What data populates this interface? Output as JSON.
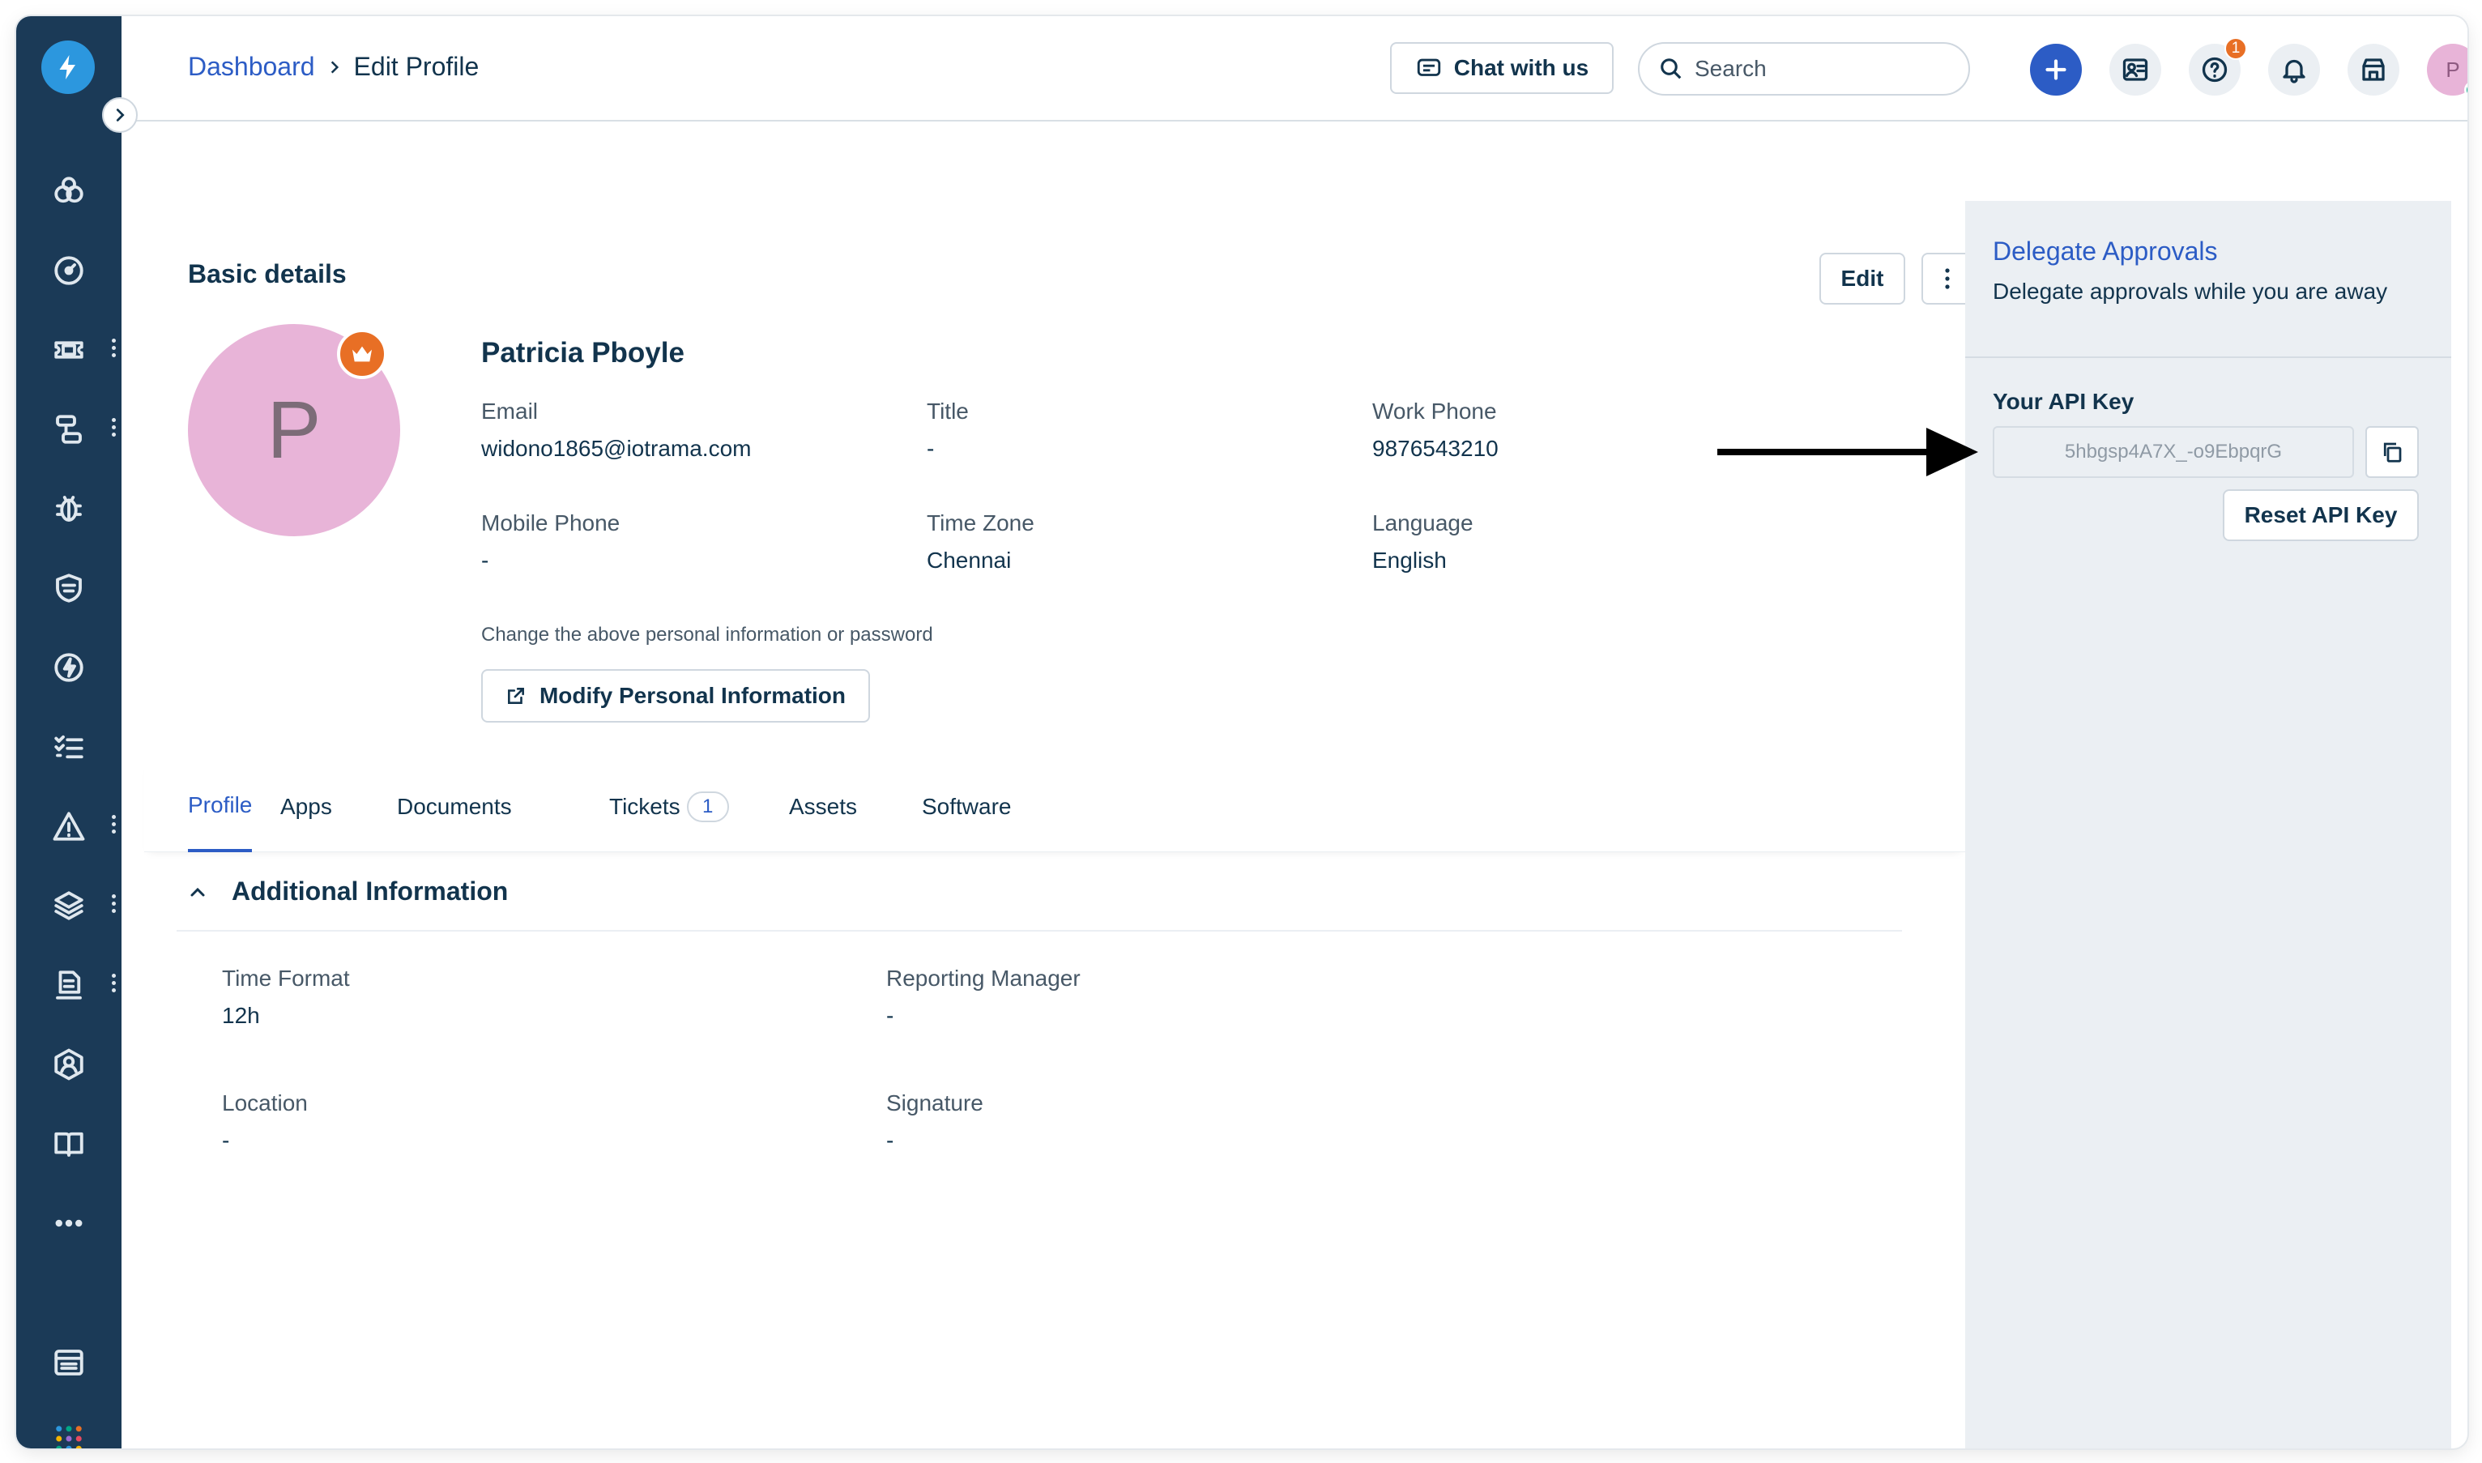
{
  "header": {
    "breadcrumb_link": "Dashboard",
    "breadcrumb_current": "Edit Profile",
    "chat_label": "Chat with us",
    "search_placeholder": "Search",
    "help_badge": "1",
    "avatar_initial": "P"
  },
  "sidebar": {
    "icons": [
      "logo-icon",
      "assets-icon",
      "dashboard-icon",
      "tickets-icon",
      "problems-icon",
      "bug-icon",
      "shield-icon",
      "changes-icon",
      "tasks-icon",
      "alerts-icon",
      "layers-icon",
      "releases-icon",
      "contacts-icon",
      "knowledge-base-icon",
      "more-icon",
      "admin-icon",
      "apps-grid-icon"
    ]
  },
  "profile": {
    "section_title": "Basic details",
    "edit_label": "Edit",
    "name": "Patricia Pboyle",
    "avatar_initial": "P",
    "fields": {
      "email_label": "Email",
      "email": "widono1865@iotrama.com",
      "title_label": "Title",
      "title": "-",
      "work_phone_label": "Work Phone",
      "work_phone": "9876543210",
      "mobile_label": "Mobile Phone",
      "mobile": "-",
      "timezone_label": "Time Zone",
      "timezone": "Chennai",
      "language_label": "Language",
      "language": "English"
    },
    "hint": "Change the above personal information or password",
    "modify_label": "Modify Personal Information"
  },
  "tabs": [
    {
      "label": "Profile"
    },
    {
      "label": "Apps"
    },
    {
      "label": "Documents"
    },
    {
      "label": "Tickets",
      "count": "1"
    },
    {
      "label": "Assets"
    },
    {
      "label": "Software"
    }
  ],
  "additional": {
    "title": "Additional Information",
    "time_format_label": "Time Format",
    "time_format": "12h",
    "reporting_manager_label": "Reporting Manager",
    "reporting_manager": "-",
    "location_label": "Location",
    "location": "-",
    "signature_label": "Signature",
    "signature": "-"
  },
  "right_panel": {
    "delegate_title": "Delegate Approvals",
    "delegate_subtitle": "Delegate approvals while you are away",
    "api_key_title": "Your API Key",
    "api_key_value": "5hbgsp4A7X_-o9EbpqrG",
    "reset_label": "Reset API Key"
  },
  "colors": {
    "sidebar": "#1b3a57",
    "accent": "#2c5cc5",
    "badge": "#e86f25",
    "avatar": "#e8b4d8",
    "online": "#00a886"
  }
}
